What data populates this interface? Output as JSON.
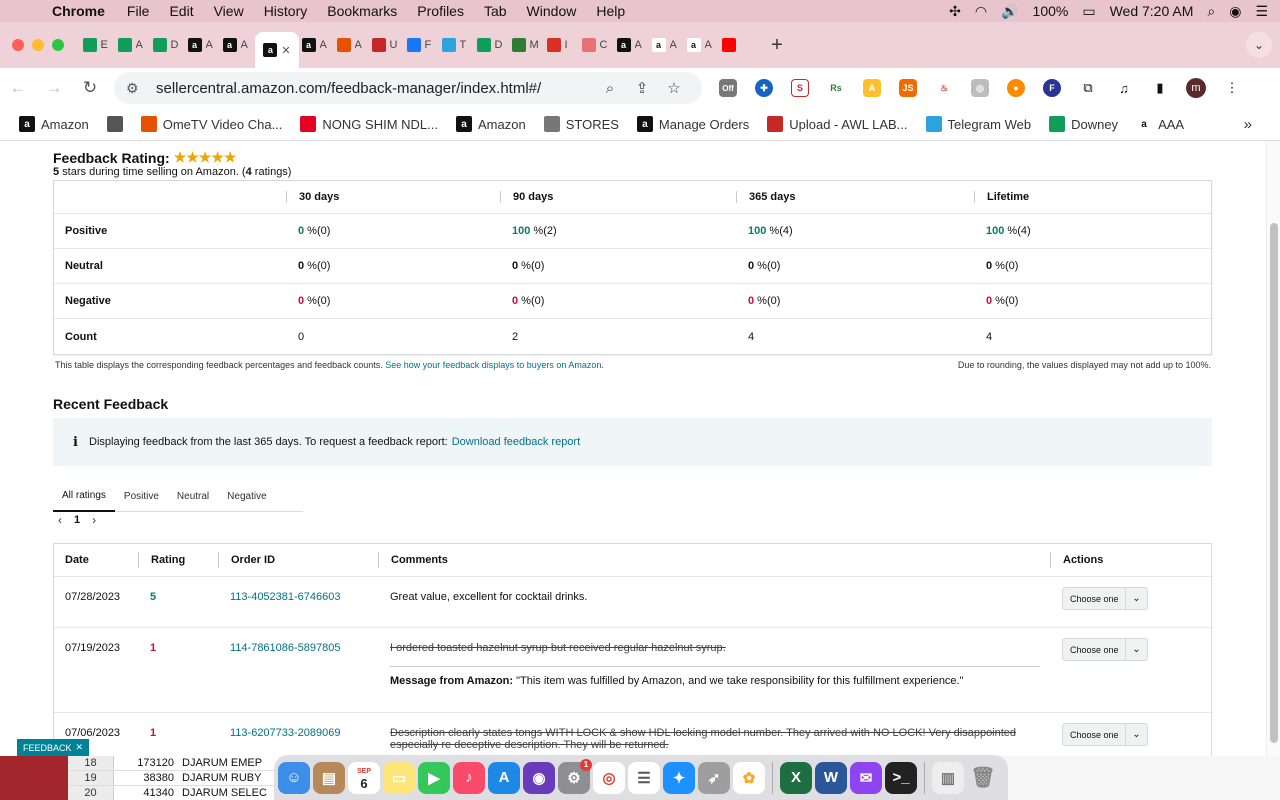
{
  "menubar": {
    "app": "Chrome",
    "items": [
      "File",
      "Edit",
      "View",
      "History",
      "Bookmarks",
      "Profiles",
      "Tab",
      "Window",
      "Help"
    ],
    "battery": "100%",
    "clock": "Wed 7:20 AM"
  },
  "tabs": [
    {
      "fav": "sheets",
      "label": "E",
      "color": "#0f9d58"
    },
    {
      "fav": "sheets",
      "label": "A",
      "color": "#0f9d58"
    },
    {
      "fav": "sheets",
      "label": "D",
      "color": "#0f9d58"
    },
    {
      "fav": "amazon",
      "label": "A",
      "color": "#111111"
    },
    {
      "fav": "amazon",
      "label": "A",
      "color": "#111111"
    },
    {
      "fav": "amazon",
      "label": "",
      "color": "#111111",
      "active": true
    },
    {
      "fav": "amazon",
      "label": "A",
      "color": "#111111"
    },
    {
      "fav": "pencil",
      "label": "A",
      "color": "#e65100"
    },
    {
      "fav": "upload",
      "label": "U",
      "color": "#c62828"
    },
    {
      "fav": "facebook",
      "label": "F",
      "color": "#1877f2"
    },
    {
      "fav": "telegram",
      "label": "T",
      "color": "#2aa3df"
    },
    {
      "fav": "sheets",
      "label": "D",
      "color": "#0f9d58"
    },
    {
      "fav": "w",
      "label": "M",
      "color": "#2e7d32"
    },
    {
      "fav": "gmail",
      "label": "I",
      "color": "#d93025"
    },
    {
      "fav": "chat",
      "label": "C",
      "color": "#e57373"
    },
    {
      "fav": "amazon",
      "label": "A",
      "color": "#111111"
    },
    {
      "fav": "amazon-a",
      "label": "A",
      "color": "#ffffff"
    },
    {
      "fav": "amazon-a",
      "label": "A",
      "color": "#ffffff"
    },
    {
      "fav": "youtube",
      "label": "",
      "color": "#ff0000"
    }
  ],
  "toolbar": {
    "url": "sellercentral.amazon.com/feedback-manager/index.html#/",
    "ext_off_label": "Off",
    "profile_initial": "m"
  },
  "bookmarks": [
    {
      "label": "Amazon",
      "icon": "amazon-icon",
      "color": "#111111"
    },
    {
      "label": "",
      "icon": "globe-icon",
      "color": "#555555"
    },
    {
      "label": "OmeTV Video Cha...",
      "icon": "ometv-icon",
      "color": "#e65100"
    },
    {
      "label": "NONG SHIM NDL...",
      "icon": "pinterest-icon",
      "color": "#e60023"
    },
    {
      "label": "Amazon",
      "icon": "amazon-icon",
      "color": "#111111"
    },
    {
      "label": "STORES",
      "icon": "folder-icon",
      "color": "#777777"
    },
    {
      "label": "Manage Orders",
      "icon": "amazon-icon",
      "color": "#111111"
    },
    {
      "label": "Upload - AWL LAB...",
      "icon": "upload-icon",
      "color": "#c62828"
    },
    {
      "label": "Telegram Web",
      "icon": "telegram-icon",
      "color": "#2aa3df"
    },
    {
      "label": "Downey",
      "icon": "sheets-icon",
      "color": "#0f9d58"
    },
    {
      "label": "AAA",
      "icon": "amazon-a-icon",
      "color": "#ffffff"
    }
  ],
  "rating": {
    "title": "Feedback Rating:",
    "stars": "★★★★★",
    "sub_stars": "5",
    "sub_text1": " stars during time selling on Amazon. (",
    "sub_count": "4",
    "sub_text2": " ratings)"
  },
  "ratings_table": {
    "headers": [
      "",
      "30 days",
      "90 days",
      "365 days",
      "Lifetime"
    ],
    "rows": [
      {
        "label": "Positive",
        "kind": "pos",
        "cells": [
          [
            "0",
            " %(0)"
          ],
          [
            "100",
            " %(2)"
          ],
          [
            "100",
            " %(4)"
          ],
          [
            "100",
            " %(4)"
          ]
        ]
      },
      {
        "label": "Neutral",
        "kind": "neu",
        "cells": [
          [
            "0",
            " %(0)"
          ],
          [
            "0",
            " %(0)"
          ],
          [
            "0",
            " %(0)"
          ],
          [
            "0",
            " %(0)"
          ]
        ]
      },
      {
        "label": "Negative",
        "kind": "neg",
        "cells": [
          [
            "0",
            " %(0)"
          ],
          [
            "0",
            " %(0)"
          ],
          [
            "0",
            " %(0)"
          ],
          [
            "0",
            " %(0)"
          ]
        ]
      },
      {
        "label": "Count",
        "kind": "count",
        "cells": [
          [
            "0",
            ""
          ],
          [
            "2",
            ""
          ],
          [
            "4",
            ""
          ],
          [
            "4",
            ""
          ]
        ]
      }
    ],
    "note_left": "This table displays the corresponding feedback percentages and feedback counts. ",
    "note_link": "See how your feedback displays to buyers on Amazon.",
    "note_right": "Due to rounding, the values displayed may not add up to 100%."
  },
  "recent": {
    "title": "Recent Feedback",
    "info_text": "Displaying feedback from the last 365 days. To request a feedback report:",
    "info_link": "Download feedback report",
    "filter_tabs": [
      "All ratings",
      "Positive",
      "Neutral",
      "Negative"
    ],
    "page": "1",
    "headers": {
      "date": "Date",
      "rating": "Rating",
      "order": "Order ID",
      "comments": "Comments",
      "actions": "Actions"
    },
    "rows": [
      {
        "date": "07/28/2023",
        "rating": "5",
        "order": "113-4052381-6746603",
        "comment": "Great value, excellent for cocktail drinks.",
        "struck": false,
        "message_label": "",
        "message": "",
        "action": "Choose one"
      },
      {
        "date": "07/19/2023",
        "rating": "1",
        "order": "114-7861086-5897805",
        "comment": "I ordered toasted hazelnut syrup but received regular hazelnut syrup.",
        "struck": true,
        "message_label": "Message from Amazon:",
        "message": " \"This item was fulfilled by Amazon, and we take responsibility for this fulfillment experience.\"",
        "action": "Choose one"
      },
      {
        "date": "07/06/2023",
        "rating": "1",
        "order": "113-6207733-2089069",
        "comment": "Description clearly states tongs WITH LOCK & show HDL locking model number. They arrived with NO LOCK! Very disappointed especially re deceptive description. They will be returned.",
        "struck": true,
        "message_label": "",
        "message": "",
        "action": "Choose one"
      }
    ]
  },
  "feedback_button": "FEEDBACK",
  "excel_rows": [
    {
      "row": "18",
      "value": "173120",
      "name": "DJARUM EMEP"
    },
    {
      "row": "19",
      "value": "38380",
      "name": "DJARUM RUBY"
    },
    {
      "row": "20",
      "value": "41340",
      "name": "DJARUM SELEC"
    }
  ],
  "dock": {
    "calendar_month": "SEP",
    "calendar_day": "6",
    "settings_badge": "1"
  }
}
